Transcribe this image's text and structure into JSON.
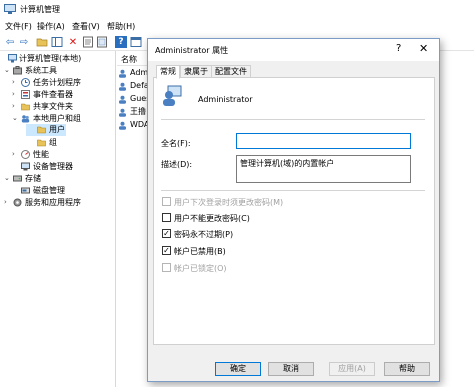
{
  "window": {
    "title": "计算机管理"
  },
  "menu": [
    "文件(F)",
    "操作(A)",
    "查看(V)",
    "帮助(H)"
  ],
  "toolbar_icons": [
    "back-arrow-icon",
    "forward-arrow-icon",
    "folder-up-icon",
    "show-hide-tree-icon",
    "delete-icon",
    "properties-icon",
    "export-list-icon",
    "help-icon",
    "console-icon"
  ],
  "tree": [
    {
      "label": "计算机管理(本地)",
      "expander": ""
    },
    {
      "label": "系统工具",
      "expander": "⌄"
    },
    {
      "label": "任务计划程序",
      "expander": "›"
    },
    {
      "label": "事件查看器",
      "expander": "›"
    },
    {
      "label": "共享文件夹",
      "expander": "›"
    },
    {
      "label": "本地用户和组",
      "expander": "⌄"
    },
    {
      "label": "用户",
      "expander": ""
    },
    {
      "label": "组",
      "expander": ""
    },
    {
      "label": "性能",
      "expander": "›"
    },
    {
      "label": "设备管理器",
      "expander": ""
    },
    {
      "label": "存储",
      "expander": "⌄"
    },
    {
      "label": "磁盘管理",
      "expander": ""
    },
    {
      "label": "服务和应用程序",
      "expander": "›"
    }
  ],
  "list": {
    "header": "名称",
    "rows": [
      "Admi",
      "Defa",
      "Gues",
      "王撸",
      "WDA"
    ]
  },
  "dialog": {
    "title": "Administrator 属性",
    "help_glyph": "?",
    "close_glyph": "✕",
    "tabs": [
      "常规",
      "隶属于",
      "配置文件"
    ],
    "username": "Administrator",
    "fullname_label": "全名(F):",
    "fullname_value": "",
    "description_label": "描述(D):",
    "description_value": "管理计算机(域)的内置帐户",
    "checkboxes": [
      {
        "label": "用户下次登录时须更改密码(M)",
        "checked": false,
        "disabled": true
      },
      {
        "label": "用户不能更改密码(C)",
        "checked": false,
        "disabled": false
      },
      {
        "label": "密码永不过期(P)",
        "checked": true,
        "disabled": false
      },
      {
        "label": "帐户已禁用(B)",
        "checked": true,
        "disabled": false
      },
      {
        "label": "帐户已锁定(O)",
        "checked": false,
        "disabled": true
      }
    ],
    "buttons": {
      "ok": "确定",
      "cancel": "取消",
      "apply": "应用(A)",
      "help": "帮助"
    },
    "check_glyph": "✓"
  },
  "colors": {
    "accent": "#0078d7",
    "disabled": "#a0a0a0",
    "dialog_bg": "#f0f0f0"
  }
}
